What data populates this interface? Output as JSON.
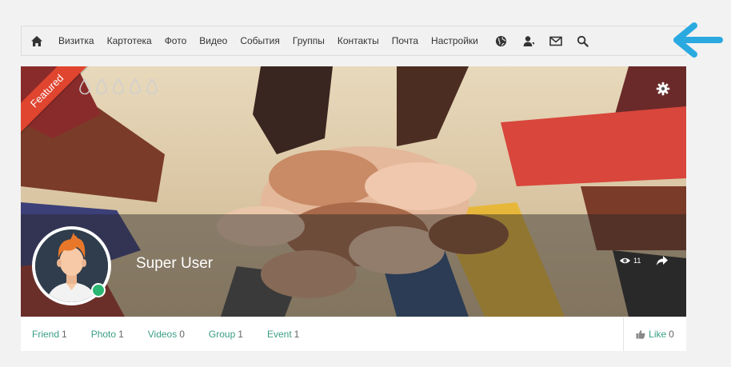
{
  "nav": {
    "items": [
      {
        "label": "Визитка"
      },
      {
        "label": "Картотека"
      },
      {
        "label": "Фото"
      },
      {
        "label": "Видео"
      },
      {
        "label": "События"
      },
      {
        "label": "Группы"
      },
      {
        "label": "Контакты"
      },
      {
        "label": "Почта"
      },
      {
        "label": "Настройки"
      }
    ],
    "icons": [
      "home-icon",
      "globe-icon",
      "user-icon",
      "mail-icon",
      "search-icon"
    ]
  },
  "cover": {
    "featured_label": "Featured",
    "rating_max": 5,
    "rating_value": 0
  },
  "profile": {
    "name": "Super User",
    "views": "11",
    "online": true
  },
  "stats": [
    {
      "label": "Friend",
      "count": "1"
    },
    {
      "label": "Photo",
      "count": "1"
    },
    {
      "label": "Videos",
      "count": "0"
    },
    {
      "label": "Group",
      "count": "1"
    },
    {
      "label": "Event",
      "count": "1"
    }
  ],
  "like": {
    "label": "Like",
    "count": "0"
  },
  "colors": {
    "accent": "#3a9e85",
    "featured": "#e0452f",
    "online": "#2bb673",
    "arrow": "#2aa9e0"
  }
}
